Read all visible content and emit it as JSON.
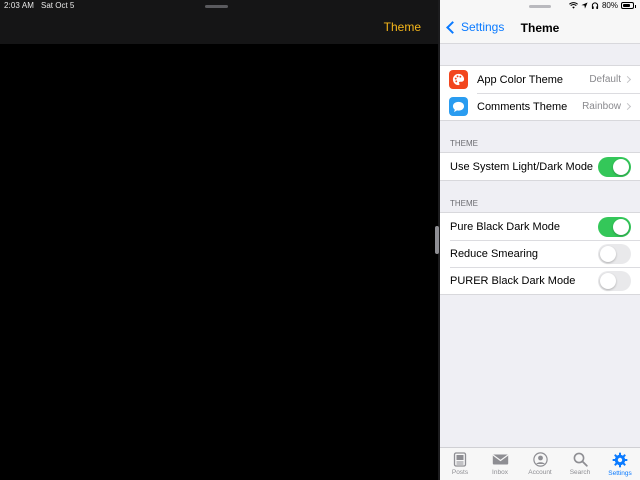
{
  "status_bar": {
    "time": "2:03 AM",
    "date": "Sat Oct 5",
    "battery": "80%"
  },
  "left_pane": {
    "theme_link": "Theme"
  },
  "nav": {
    "back_label": "Settings",
    "title": "Theme"
  },
  "groups": {
    "general": [
      {
        "label": "App Color Theme",
        "value": "Default",
        "icon": "palette-icon",
        "icon_color": "#f2461e"
      },
      {
        "label": "Comments Theme",
        "value": "Rainbow",
        "icon": "chat-bubble-icon",
        "icon_color": "#2a9cf0"
      }
    ]
  },
  "sections": {
    "system_header": "THEME",
    "dark_header": "THEME"
  },
  "toggles": {
    "system": {
      "label": "Use System Light/Dark Mode",
      "on": true
    },
    "pure_black": {
      "label": "Pure Black Dark Mode",
      "on": true
    },
    "reduce_smearing": {
      "label": "Reduce Smearing",
      "on": false
    },
    "purer_black": {
      "label": "PURER Black Dark Mode",
      "on": false
    }
  },
  "tabs": [
    {
      "label": "Posts",
      "icon": "posts-icon",
      "active": false
    },
    {
      "label": "Inbox",
      "icon": "inbox-icon",
      "active": false
    },
    {
      "label": "Account",
      "icon": "account-icon",
      "active": false
    },
    {
      "label": "Search",
      "icon": "search-icon",
      "active": false
    },
    {
      "label": "Settings",
      "icon": "gear-icon",
      "active": true
    }
  ],
  "colors": {
    "accent": "#0a7aff",
    "toggle_on": "#34c759",
    "left_link": "#f5b61a"
  }
}
